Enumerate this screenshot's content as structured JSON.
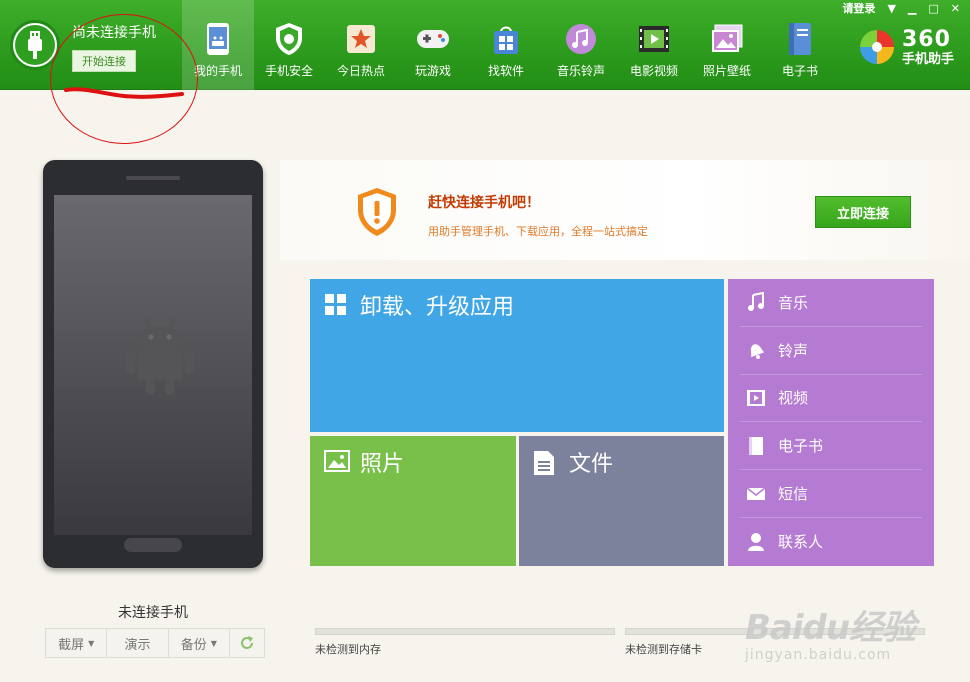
{
  "header": {
    "connection_status": "尚未连接手机",
    "start_connect_label": "开始连接",
    "login_label": "请登录",
    "brand_number": "360",
    "brand_name": "手机助手"
  },
  "nav_tabs": [
    {
      "label": "我的手机",
      "icon": "phone-icon",
      "active": true
    },
    {
      "label": "手机安全",
      "icon": "shield-icon"
    },
    {
      "label": "今日热点",
      "icon": "star-icon"
    },
    {
      "label": "玩游戏",
      "icon": "gamepad-icon"
    },
    {
      "label": "找软件",
      "icon": "bag-icon"
    },
    {
      "label": "音乐铃声",
      "icon": "music-icon"
    },
    {
      "label": "电影视频",
      "icon": "film-icon"
    },
    {
      "label": "照片壁纸",
      "icon": "picture-icon"
    },
    {
      "label": "电子书",
      "icon": "book-icon"
    }
  ],
  "phone_panel": {
    "label": "未连接手机",
    "actions": {
      "screenshot": "截屏",
      "demo": "演示",
      "backup": "备份"
    }
  },
  "banner": {
    "title": "赶快连接手机吧！",
    "subtitle": "用助手管理手机、下载应用，全程一站式搞定",
    "button_label": "立即连接"
  },
  "tiles": {
    "apps": "卸载、升级应用",
    "photos": "照片",
    "files": "文件"
  },
  "side_list": [
    {
      "label": "音乐",
      "icon": "music-note-icon"
    },
    {
      "label": "铃声",
      "icon": "bell-icon"
    },
    {
      "label": "视频",
      "icon": "video-icon"
    },
    {
      "label": "电子书",
      "icon": "ebook-icon"
    },
    {
      "label": "短信",
      "icon": "envelope-icon"
    },
    {
      "label": "联系人",
      "icon": "person-icon"
    }
  ],
  "storage": {
    "memory_label": "未检测到内存",
    "sdcard_label": "未检测到存储卡"
  },
  "watermark": {
    "logo": "Baidu经验",
    "url": "jingyan.baidu.com"
  },
  "colors": {
    "header_green": "#2c9a1c",
    "apps_tile": "#41a6e6",
    "photos_tile": "#79c04b",
    "files_tile": "#7d829c",
    "side_list": "#b57ad2",
    "banner_title": "#c33a00",
    "annotation_red": "#dd1111"
  }
}
